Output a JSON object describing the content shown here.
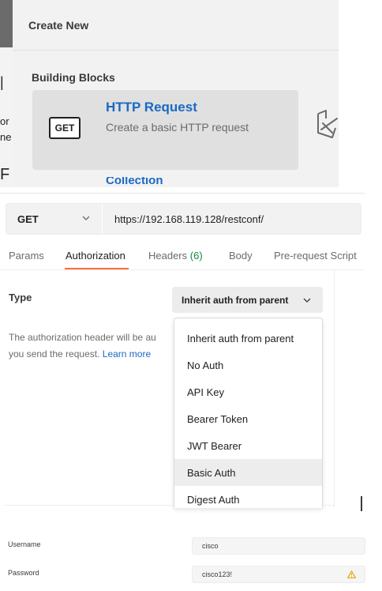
{
  "create_panel": {
    "title": "Create New",
    "section": "Building Blocks",
    "http_card": {
      "badge": "GET",
      "title": "HTTP Request",
      "description": "Create a basic HTTP request"
    },
    "next_card_peek": "Collection",
    "left_fragments": [
      "or",
      "ne",
      "F"
    ]
  },
  "request": {
    "method": "GET",
    "url": "https://192.168.119.128/restconf/"
  },
  "tabs": {
    "params": "Params",
    "authorization": "Authorization",
    "headers": "Headers",
    "headers_count": "(6)",
    "body": "Body",
    "prerequest": "Pre-request Script"
  },
  "auth": {
    "type_label": "Type",
    "selected": "Inherit auth from parent",
    "help_line1": "The authorization header will be au",
    "help_line2": "you send the request.",
    "learn_more": "Learn more",
    "options": [
      "Inherit auth from parent",
      "No Auth",
      "API Key",
      "Bearer Token",
      "JWT Bearer",
      "Basic Auth",
      "Digest Auth"
    ],
    "hovered_option": "Basic Auth"
  },
  "credentials": {
    "username_label": "Username",
    "username_value": "cisco",
    "password_label": "Password",
    "password_value": "cisco123!"
  },
  "colors": {
    "accent_orange": "#ff6c37",
    "link_blue": "#1a69c4",
    "count_green": "#0c8c38",
    "warning_yellow": "#e7a400"
  }
}
